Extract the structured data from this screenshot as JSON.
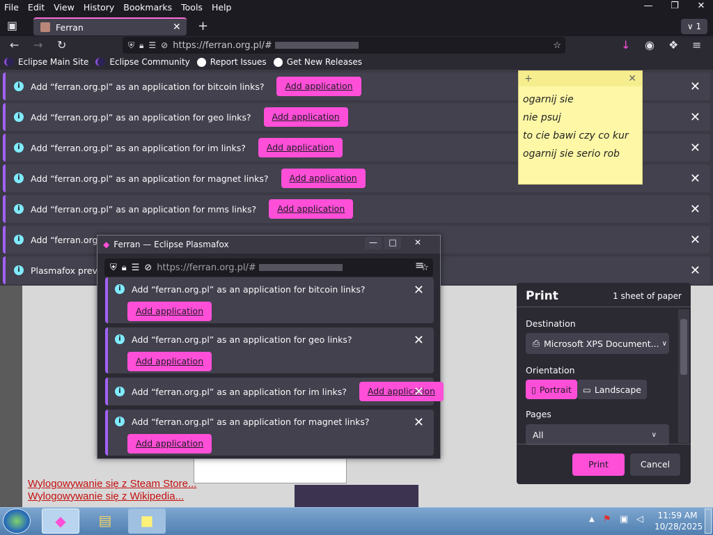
{
  "menu": [
    "File",
    "Edit",
    "View",
    "History",
    "Bookmarks",
    "Tools",
    "Help"
  ],
  "tab": {
    "title": "Ferran",
    "count": "1"
  },
  "url": {
    "text": "https://ferran.org.pl/#"
  },
  "bookmarks": [
    {
      "label": "Eclipse Main Site"
    },
    {
      "label": "Eclipse Community"
    },
    {
      "label": "Report Issues"
    },
    {
      "label": "Get New Releases"
    }
  ],
  "notifications": [
    {
      "msg": "Add “ferran.org.pl” as an application for bitcoin links?",
      "button": "Add application"
    },
    {
      "msg": "Add “ferran.org.pl” as an application for geo links?",
      "button": "Add application"
    },
    {
      "msg": "Add “ferran.org.pl” as an application for im links?",
      "button": "Add application"
    },
    {
      "msg": "Add “ferran.org.pl” as an application for magnet links?",
      "button": "Add application"
    },
    {
      "msg": "Add “ferran.org.pl” as an application for mms links?",
      "button": "Add application"
    },
    {
      "msg": "Add “ferran.org.pl”",
      "button": ""
    },
    {
      "msg": "Plasmafox prevent",
      "button": ""
    }
  ],
  "note": {
    "lines": [
      "ogarnij sie",
      "nie psuj",
      "to cie bawi czy co kur",
      "ogarnij sie serio rob"
    ]
  },
  "popup": {
    "title": "Ferran — Eclipse Plasmafox",
    "url": "https://ferran.org.pl/#",
    "notifications": [
      {
        "msg": "Add “ferran.org.pl” as an application for bitcoin links?",
        "button": "Add application"
      },
      {
        "msg": "Add “ferran.org.pl” as an application for geo links?",
        "button": "Add application"
      },
      {
        "msg": "Add “ferran.org.pl” as an application for im links?",
        "button": "Add application"
      },
      {
        "msg": "Add “ferran.org.pl” as an application for magnet links?",
        "button": "Add application"
      }
    ]
  },
  "print": {
    "title": "Print",
    "sheets": "1 sheet of paper",
    "destination_label": "Destination",
    "destination": "Microsoft XPS Document...",
    "orientation_label": "Orientation",
    "portrait": "Portrait",
    "landscape": "Landscape",
    "pages_label": "Pages",
    "pages": "All",
    "print_button": "Print",
    "cancel_button": "Cancel"
  },
  "page_links": [
    "Wylogowywanie się z Steam Store...",
    "Wylogowywanie się z Wikipedia..."
  ],
  "clock": {
    "time": "11:59 AM",
    "date": "10/28/2025"
  },
  "colors": {
    "accent": "#ff4fd8",
    "notif_border": "#a162f7",
    "info": "#80ebff",
    "note": "#fdf7a6"
  }
}
